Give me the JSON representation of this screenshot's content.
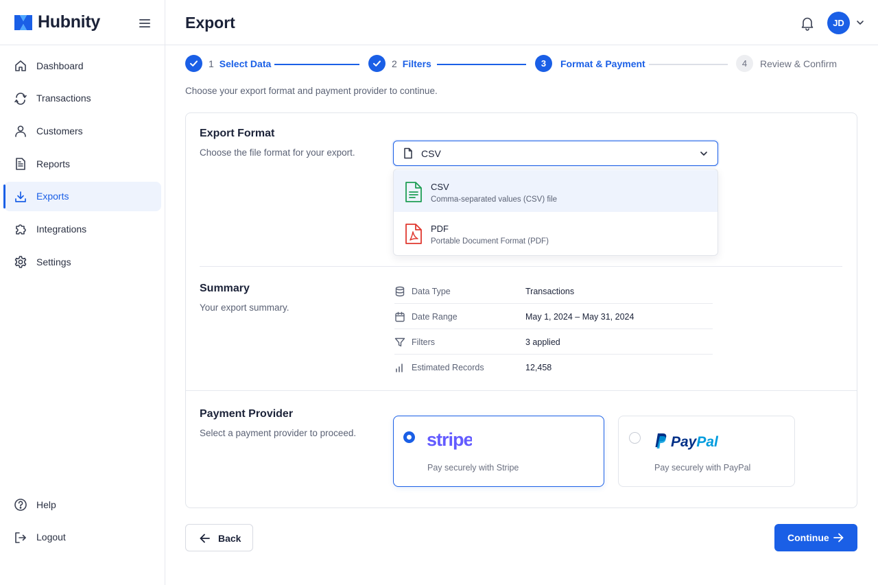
{
  "brand": {
    "name": "Hubnity",
    "accent": "#1a5fe6"
  },
  "header": {
    "title": "Export",
    "avatar_initials": "JD"
  },
  "sidebar": {
    "items": [
      {
        "label": "Dashboard",
        "icon": "home-icon",
        "active": false
      },
      {
        "label": "Transactions",
        "icon": "transactions-icon",
        "active": false
      },
      {
        "label": "Customers",
        "icon": "user-icon",
        "active": false
      },
      {
        "label": "Reports",
        "icon": "report-icon",
        "active": false
      },
      {
        "label": "Exports",
        "icon": "download-icon",
        "active": true
      },
      {
        "label": "Integrations",
        "icon": "puzzle-icon",
        "active": false
      },
      {
        "label": "Settings",
        "icon": "gear-icon",
        "active": false
      }
    ],
    "bottom": [
      {
        "label": "Help",
        "icon": "help-icon"
      },
      {
        "label": "Logout",
        "icon": "logout-icon"
      }
    ]
  },
  "stepper": {
    "steps": [
      {
        "num": "1",
        "label": "Select Data",
        "state": "done"
      },
      {
        "num": "2",
        "label": "Filters",
        "state": "done"
      },
      {
        "num": "3",
        "label": "Format & Payment",
        "state": "active"
      },
      {
        "num": "4",
        "label": "Review & Confirm",
        "state": "todo"
      }
    ]
  },
  "subtitle": "Choose your export format and payment provider to continue.",
  "export_format": {
    "title": "Export Format",
    "desc": "Choose the file format for your export.",
    "selected": "CSV",
    "options": [
      {
        "title": "CSV",
        "sub": "Comma-separated values (CSV) file",
        "icon": "csv-file-icon",
        "highlighted": true
      },
      {
        "title": "PDF",
        "sub": "Portable Document Format (PDF)",
        "icon": "pdf-file-icon",
        "highlighted": false
      }
    ]
  },
  "summary": {
    "title": "Summary",
    "desc": "Your export summary.",
    "rows": [
      {
        "label": "Data Type",
        "value": "Transactions",
        "icon": "database-icon"
      },
      {
        "label": "Date Range",
        "value": "May 1, 2024 – May 31, 2024",
        "icon": "calendar-icon"
      },
      {
        "label": "Filters",
        "value": "3 applied",
        "icon": "filter-icon"
      },
      {
        "label": "Estimated Records",
        "value": "12,458",
        "icon": "bar-chart-icon"
      }
    ]
  },
  "payment": {
    "title": "Payment Provider",
    "desc": "Select a payment provider to proceed.",
    "providers": [
      {
        "name": "stripe",
        "desc": "Pay securely with Stripe",
        "selected": true
      },
      {
        "name": "PayPal",
        "desc": "Pay securely with PayPal",
        "selected": false
      }
    ]
  },
  "footer": {
    "back_label": "Back",
    "continue_label": "Continue"
  }
}
